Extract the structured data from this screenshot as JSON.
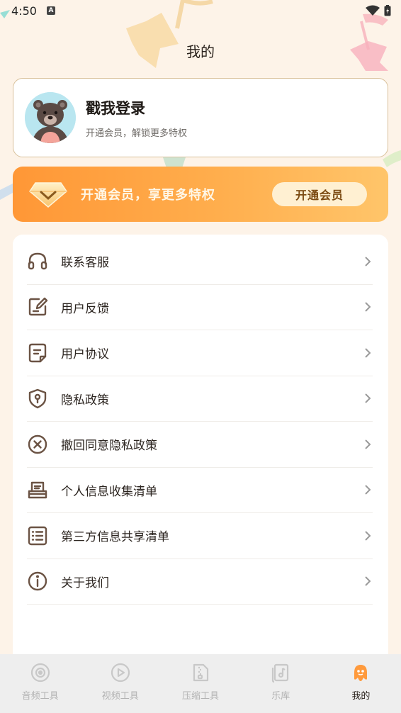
{
  "status_bar": {
    "time": "4:50",
    "notif_badge": "A"
  },
  "header": {
    "title": "我的"
  },
  "user": {
    "name": "戳我登录",
    "subtitle": "开通会员，解锁更多特权"
  },
  "vip": {
    "text": "开通会员，享更多特权",
    "button_label": "开通会员"
  },
  "menu": {
    "items": [
      {
        "label": "联系客服",
        "icon": "headset-icon"
      },
      {
        "label": "用户反馈",
        "icon": "edit-note-icon"
      },
      {
        "label": "用户协议",
        "icon": "document-icon"
      },
      {
        "label": "隐私政策",
        "icon": "shield-icon"
      },
      {
        "label": "撤回同意隐私政策",
        "icon": "cancel-circle-icon"
      },
      {
        "label": "个人信息收集清单",
        "icon": "inbox-icon"
      },
      {
        "label": "第三方信息共享清单",
        "icon": "list-icon"
      },
      {
        "label": "关于我们",
        "icon": "info-icon"
      }
    ]
  },
  "tabbar": {
    "tabs": [
      {
        "label": "音频工具",
        "icon": "audio-disc-icon"
      },
      {
        "label": "视频工具",
        "icon": "play-icon"
      },
      {
        "label": "压缩工具",
        "icon": "zip-file-icon"
      },
      {
        "label": "乐库",
        "icon": "music-library-icon"
      },
      {
        "label": "我的",
        "icon": "profile-ghost-icon"
      }
    ],
    "active_index": 4
  },
  "colors": {
    "background": "#fdf3e8",
    "accent_orange": "#ff9736",
    "icon_brown": "#6b5344",
    "inactive_gray": "#b3b3b3"
  }
}
